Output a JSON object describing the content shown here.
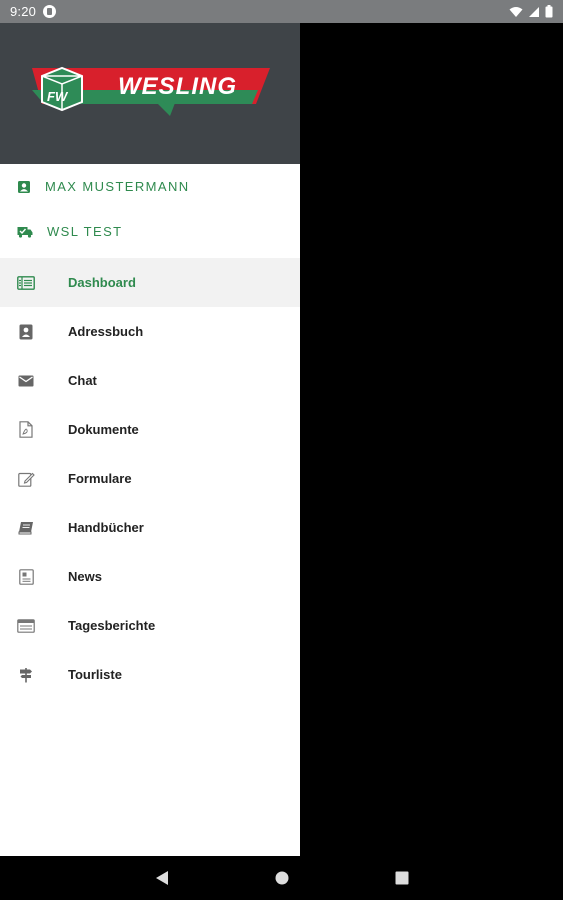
{
  "status_bar": {
    "time": "9:20",
    "icons": [
      "app-notification-icon",
      "wifi-icon",
      "signal-icon",
      "battery-icon"
    ]
  },
  "header": {
    "logo_text": "WESLING",
    "logo_badge": "FW",
    "colors": {
      "background": "#3f4448",
      "brand_red": "#d8202c",
      "brand_green": "#2e8b57"
    }
  },
  "accounts": [
    {
      "icon": "user-badge-icon",
      "label": "MAX MUSTERMANN"
    },
    {
      "icon": "truck-check-icon",
      "label": "WSL TEST"
    }
  ],
  "menu": [
    {
      "icon": "dashboard-icon",
      "label": "Dashboard",
      "active": true
    },
    {
      "icon": "addressbook-icon",
      "label": "Adressbuch"
    },
    {
      "icon": "mail-icon",
      "label": "Chat"
    },
    {
      "icon": "pdf-file-icon",
      "label": "Dokumente"
    },
    {
      "icon": "edit-form-icon",
      "label": "Formulare"
    },
    {
      "icon": "book-icon",
      "label": "Handbücher"
    },
    {
      "icon": "newspaper-icon",
      "label": "News"
    },
    {
      "icon": "daily-report-icon",
      "label": "Tagesberichte"
    },
    {
      "icon": "signpost-icon",
      "label": "Tourliste"
    }
  ],
  "colors": {
    "accent": "#2f8a4e",
    "active_bg": "#f2f2f2",
    "scrim": "#000000"
  },
  "nav_bar": {
    "buttons": [
      "back-icon",
      "home-icon",
      "recents-icon"
    ]
  }
}
